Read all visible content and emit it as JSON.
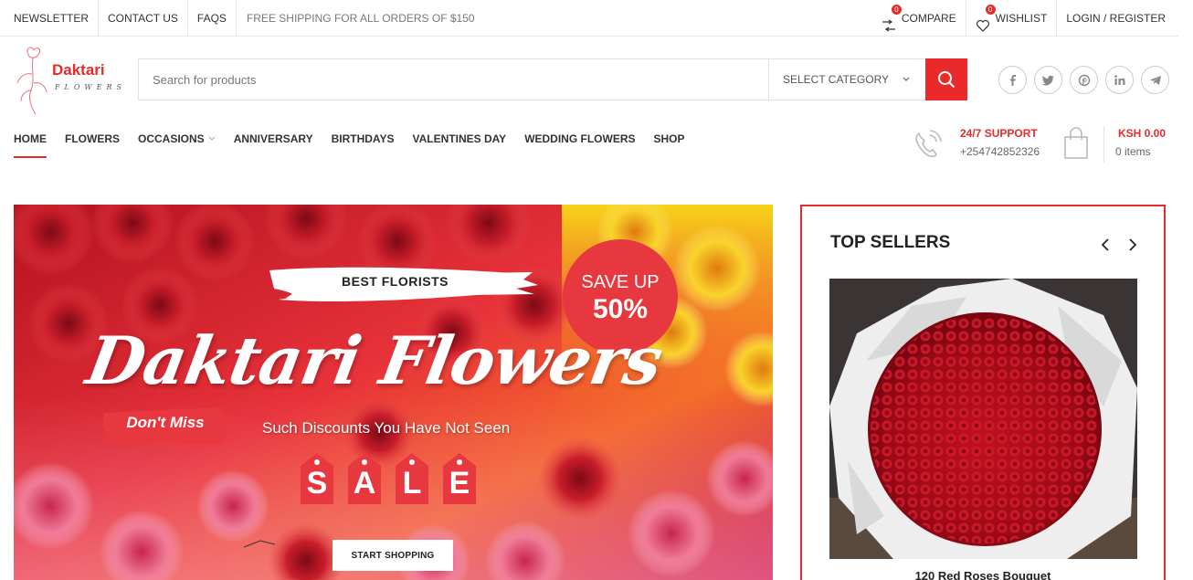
{
  "topbar": {
    "links": [
      "NEWSLETTER",
      "CONTACT US",
      "FAQS"
    ],
    "shipping": "FREE SHIPPING FOR ALL ORDERS OF $150",
    "compare_label": "COMPARE",
    "compare_count": "0",
    "wishlist_label": "WISHLIST",
    "wishlist_count": "0",
    "login_label": "LOGIN / REGISTER"
  },
  "logo": {
    "brand": "Daktari",
    "sub": "FLOWERS"
  },
  "search": {
    "placeholder": "Search for products",
    "category": "SELECT CATEGORY"
  },
  "socials": [
    "facebook-icon",
    "twitter-icon",
    "pinterest-icon",
    "linkedin-icon",
    "telegram-icon"
  ],
  "nav": {
    "items": [
      "HOME",
      "FLOWERS",
      "OCCASIONS",
      "ANNIVERSARY",
      "BIRTHDAYS",
      "VALENTINES DAY",
      "WEDDING FLOWERS",
      "SHOP"
    ],
    "active": "HOME"
  },
  "support": {
    "title": "24/7 SUPPORT",
    "phone": "+254742852326"
  },
  "cart": {
    "total": "KSH 0.00",
    "items": "0 items"
  },
  "hero": {
    "best": "BEST FLORISTS",
    "save_up": "SAVE UP",
    "save_pct": "50%",
    "script": "Daktari Flowers",
    "dont_miss": "Don't Miss",
    "tagline": "Such Discounts You Have Not Seen",
    "sale_letters": [
      "S",
      "A",
      "L",
      "E"
    ],
    "button": "START SHOPPING"
  },
  "sellers": {
    "title": "TOP SELLERS",
    "product_name": "120 Red Roses Bouquet"
  },
  "colors": {
    "accent": "#e52c2c",
    "text": "#333333"
  }
}
